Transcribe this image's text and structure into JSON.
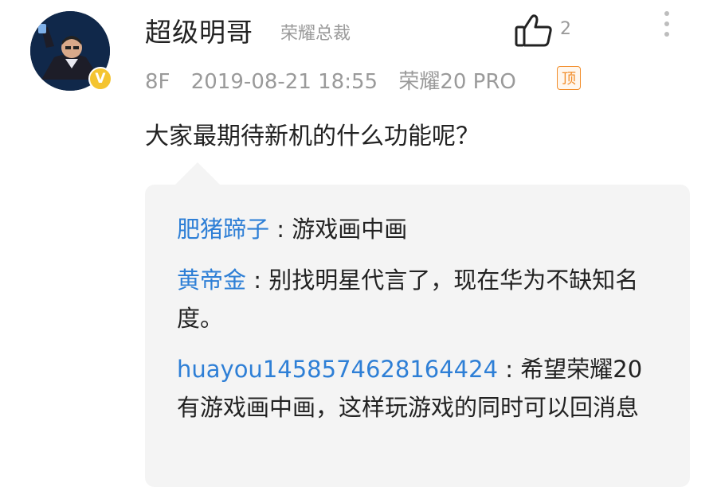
{
  "comment": {
    "username": "超级明哥",
    "user_title": "荣耀总裁",
    "like_count": "2",
    "floor": "8F",
    "datetime": "2019-08-21 18:55",
    "device": "荣耀20 PRO",
    "top_badge": "顶",
    "vip_badge": "V",
    "text": "大家最期待新机的什么功能呢？"
  },
  "replies": [
    {
      "name": "肥猪蹄子",
      "sep": " : ",
      "text": "游戏画中画"
    },
    {
      "name": "黄帝金",
      "sep": " : ",
      "text": "别找明星代言了，现在华为不缺知名度。"
    },
    {
      "name": "huayou1458574628164424",
      "sep": " : ",
      "text": "希望荣耀20有游戏画中画，这样玩游戏的同时可以回消息"
    }
  ],
  "colors": {
    "link_blue": "#2e7fd6",
    "muted_gray": "#9a9a9a",
    "top_badge_orange": "#f28c28",
    "vip_gold": "#f4c430",
    "reply_bg": "#f4f4f4"
  },
  "icons": [
    "thumbs-up-icon",
    "more-vertical-icon",
    "vip-badge-icon"
  ]
}
